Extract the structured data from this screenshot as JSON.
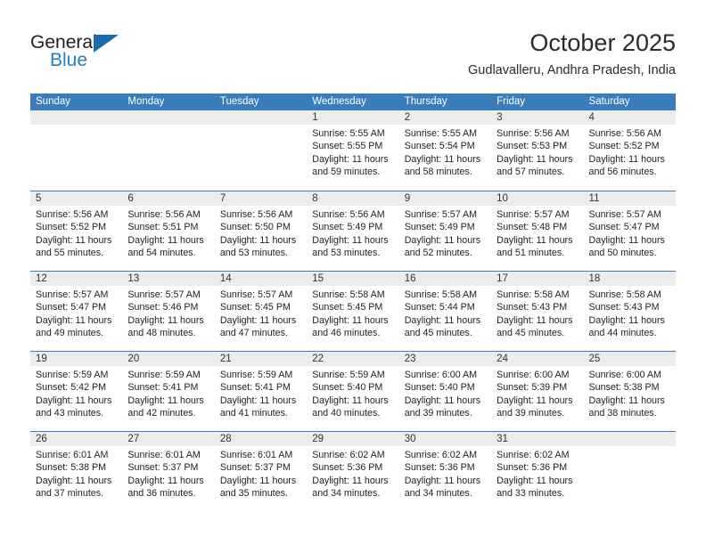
{
  "brand": {
    "word_one": "General",
    "word_two": "Blue",
    "logo_icon": "triangle-flag-icon"
  },
  "header": {
    "title": "October 2025",
    "subtitle": "Gudlavalleru, Andhra Pradesh, India"
  },
  "colors": {
    "header_blue": "#3a7dbd",
    "brand_blue": "#1f7fc4",
    "logo_blue": "#1b6cae",
    "day_number_band": "#ececec",
    "text": "#222222"
  },
  "calendar": {
    "day_names": [
      "Sunday",
      "Monday",
      "Tuesday",
      "Wednesday",
      "Thursday",
      "Friday",
      "Saturday"
    ],
    "weeks": [
      [
        {
          "day": "",
          "lines": []
        },
        {
          "day": "",
          "lines": []
        },
        {
          "day": "",
          "lines": []
        },
        {
          "day": "1",
          "lines": [
            "Sunrise: 5:55 AM",
            "Sunset: 5:55 PM",
            "Daylight: 11 hours",
            "and 59 minutes."
          ]
        },
        {
          "day": "2",
          "lines": [
            "Sunrise: 5:55 AM",
            "Sunset: 5:54 PM",
            "Daylight: 11 hours",
            "and 58 minutes."
          ]
        },
        {
          "day": "3",
          "lines": [
            "Sunrise: 5:56 AM",
            "Sunset: 5:53 PM",
            "Daylight: 11 hours",
            "and 57 minutes."
          ]
        },
        {
          "day": "4",
          "lines": [
            "Sunrise: 5:56 AM",
            "Sunset: 5:52 PM",
            "Daylight: 11 hours",
            "and 56 minutes."
          ]
        }
      ],
      [
        {
          "day": "5",
          "lines": [
            "Sunrise: 5:56 AM",
            "Sunset: 5:52 PM",
            "Daylight: 11 hours",
            "and 55 minutes."
          ]
        },
        {
          "day": "6",
          "lines": [
            "Sunrise: 5:56 AM",
            "Sunset: 5:51 PM",
            "Daylight: 11 hours",
            "and 54 minutes."
          ]
        },
        {
          "day": "7",
          "lines": [
            "Sunrise: 5:56 AM",
            "Sunset: 5:50 PM",
            "Daylight: 11 hours",
            "and 53 minutes."
          ]
        },
        {
          "day": "8",
          "lines": [
            "Sunrise: 5:56 AM",
            "Sunset: 5:49 PM",
            "Daylight: 11 hours",
            "and 53 minutes."
          ]
        },
        {
          "day": "9",
          "lines": [
            "Sunrise: 5:57 AM",
            "Sunset: 5:49 PM",
            "Daylight: 11 hours",
            "and 52 minutes."
          ]
        },
        {
          "day": "10",
          "lines": [
            "Sunrise: 5:57 AM",
            "Sunset: 5:48 PM",
            "Daylight: 11 hours",
            "and 51 minutes."
          ]
        },
        {
          "day": "11",
          "lines": [
            "Sunrise: 5:57 AM",
            "Sunset: 5:47 PM",
            "Daylight: 11 hours",
            "and 50 minutes."
          ]
        }
      ],
      [
        {
          "day": "12",
          "lines": [
            "Sunrise: 5:57 AM",
            "Sunset: 5:47 PM",
            "Daylight: 11 hours",
            "and 49 minutes."
          ]
        },
        {
          "day": "13",
          "lines": [
            "Sunrise: 5:57 AM",
            "Sunset: 5:46 PM",
            "Daylight: 11 hours",
            "and 48 minutes."
          ]
        },
        {
          "day": "14",
          "lines": [
            "Sunrise: 5:57 AM",
            "Sunset: 5:45 PM",
            "Daylight: 11 hours",
            "and 47 minutes."
          ]
        },
        {
          "day": "15",
          "lines": [
            "Sunrise: 5:58 AM",
            "Sunset: 5:45 PM",
            "Daylight: 11 hours",
            "and 46 minutes."
          ]
        },
        {
          "day": "16",
          "lines": [
            "Sunrise: 5:58 AM",
            "Sunset: 5:44 PM",
            "Daylight: 11 hours",
            "and 45 minutes."
          ]
        },
        {
          "day": "17",
          "lines": [
            "Sunrise: 5:58 AM",
            "Sunset: 5:43 PM",
            "Daylight: 11 hours",
            "and 45 minutes."
          ]
        },
        {
          "day": "18",
          "lines": [
            "Sunrise: 5:58 AM",
            "Sunset: 5:43 PM",
            "Daylight: 11 hours",
            "and 44 minutes."
          ]
        }
      ],
      [
        {
          "day": "19",
          "lines": [
            "Sunrise: 5:59 AM",
            "Sunset: 5:42 PM",
            "Daylight: 11 hours",
            "and 43 minutes."
          ]
        },
        {
          "day": "20",
          "lines": [
            "Sunrise: 5:59 AM",
            "Sunset: 5:41 PM",
            "Daylight: 11 hours",
            "and 42 minutes."
          ]
        },
        {
          "day": "21",
          "lines": [
            "Sunrise: 5:59 AM",
            "Sunset: 5:41 PM",
            "Daylight: 11 hours",
            "and 41 minutes."
          ]
        },
        {
          "day": "22",
          "lines": [
            "Sunrise: 5:59 AM",
            "Sunset: 5:40 PM",
            "Daylight: 11 hours",
            "and 40 minutes."
          ]
        },
        {
          "day": "23",
          "lines": [
            "Sunrise: 6:00 AM",
            "Sunset: 5:40 PM",
            "Daylight: 11 hours",
            "and 39 minutes."
          ]
        },
        {
          "day": "24",
          "lines": [
            "Sunrise: 6:00 AM",
            "Sunset: 5:39 PM",
            "Daylight: 11 hours",
            "and 39 minutes."
          ]
        },
        {
          "day": "25",
          "lines": [
            "Sunrise: 6:00 AM",
            "Sunset: 5:38 PM",
            "Daylight: 11 hours",
            "and 38 minutes."
          ]
        }
      ],
      [
        {
          "day": "26",
          "lines": [
            "Sunrise: 6:01 AM",
            "Sunset: 5:38 PM",
            "Daylight: 11 hours",
            "and 37 minutes."
          ]
        },
        {
          "day": "27",
          "lines": [
            "Sunrise: 6:01 AM",
            "Sunset: 5:37 PM",
            "Daylight: 11 hours",
            "and 36 minutes."
          ]
        },
        {
          "day": "28",
          "lines": [
            "Sunrise: 6:01 AM",
            "Sunset: 5:37 PM",
            "Daylight: 11 hours",
            "and 35 minutes."
          ]
        },
        {
          "day": "29",
          "lines": [
            "Sunrise: 6:02 AM",
            "Sunset: 5:36 PM",
            "Daylight: 11 hours",
            "and 34 minutes."
          ]
        },
        {
          "day": "30",
          "lines": [
            "Sunrise: 6:02 AM",
            "Sunset: 5:36 PM",
            "Daylight: 11 hours",
            "and 34 minutes."
          ]
        },
        {
          "day": "31",
          "lines": [
            "Sunrise: 6:02 AM",
            "Sunset: 5:36 PM",
            "Daylight: 11 hours",
            "and 33 minutes."
          ]
        },
        {
          "day": "",
          "lines": []
        }
      ]
    ]
  }
}
